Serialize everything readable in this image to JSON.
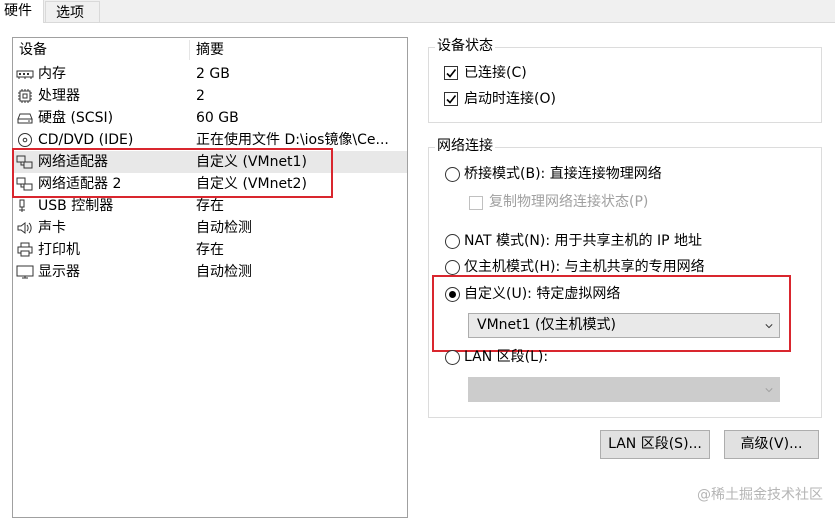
{
  "tabs": [
    {
      "label": "硬件"
    },
    {
      "label": "选项"
    }
  ],
  "device_list": {
    "headers": {
      "device": "设备",
      "summary": "摘要"
    },
    "rows": [
      {
        "icon": "memory-icon",
        "device": "内存",
        "summary": "2 GB"
      },
      {
        "icon": "processor-icon",
        "device": "处理器",
        "summary": "2"
      },
      {
        "icon": "hard-disk-icon",
        "device": "硬盘 (SCSI)",
        "summary": "60 GB"
      },
      {
        "icon": "cd-dvd-icon",
        "device": "CD/DVD (IDE)",
        "summary": "正在使用文件 D:\\ios镜像\\Ce..."
      },
      {
        "icon": "network-adapter-icon",
        "device": "网络适配器",
        "summary": "自定义 (VMnet1)"
      },
      {
        "icon": "network-adapter-icon",
        "device": "网络适配器 2",
        "summary": "自定义 (VMnet2)"
      },
      {
        "icon": "usb-controller-icon",
        "device": "USB 控制器",
        "summary": "存在"
      },
      {
        "icon": "sound-card-icon",
        "device": "声卡",
        "summary": "自动检测"
      },
      {
        "icon": "printer-icon",
        "device": "打印机",
        "summary": "存在"
      },
      {
        "icon": "display-icon",
        "device": "显示器",
        "summary": "自动检测"
      }
    ]
  },
  "device_status": {
    "title": "设备状态",
    "connected": {
      "label": "已连接(C)",
      "checked": true
    },
    "connect_at_power_on": {
      "label": "启动时连接(O)",
      "checked": true
    }
  },
  "network_connection": {
    "title": "网络连接",
    "bridged": {
      "label": "桥接模式(B): 直接连接物理网络",
      "selected": false
    },
    "replicate": {
      "label": "复制物理网络连接状态(P)",
      "checked": false
    },
    "nat": {
      "label": "NAT 模式(N): 用于共享主机的 IP 地址",
      "selected": false
    },
    "host_only": {
      "label": "仅主机模式(H): 与主机共享的专用网络",
      "selected": false
    },
    "custom": {
      "label": "自定义(U): 特定虚拟网络",
      "selected": true
    },
    "custom_select_value": "VMnet1 (仅主机模式)",
    "lan_segment": {
      "label": "LAN 区段(L):",
      "selected": false
    },
    "lan_select_value": ""
  },
  "buttons": {
    "lan_segments": "LAN 区段(S)...",
    "advanced": "高级(V)..."
  },
  "watermark": "@稀土掘金技术社区",
  "colors": {
    "highlight_box": "#d9262e",
    "selected_row": "#e8e8e8"
  }
}
